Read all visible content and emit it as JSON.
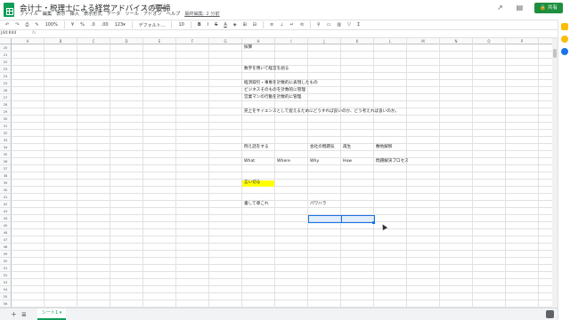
{
  "title": "会计士・税理士による経営アドバイスの要諦",
  "menu": [
    "ファイル",
    "編集",
    "表示",
    "挿入",
    "表示形式",
    "データ",
    "ツール",
    "アドオン",
    "ヘルプ",
    "最終編集: 2 分前"
  ],
  "share_label": "共有",
  "toolbar": {
    "zoom": "100%",
    "currency": "¥",
    "percent": "%",
    "dec0": ".0",
    "dec00": ".00",
    "numfmt": "123▾",
    "font": "デフォルト...",
    "size": "10",
    "bold": "B",
    "italic": "I",
    "strike": "S",
    "textcolor": "A"
  },
  "formula": {
    "namebox": "J44:K44",
    "fx": "fx"
  },
  "columns": [
    "A",
    "B",
    "C",
    "D",
    "E",
    "F",
    "G",
    "H",
    "I",
    "J",
    "K",
    "L",
    "M",
    "N",
    "O",
    "P",
    "Q"
  ],
  "rows": [
    "20",
    "21",
    "22",
    "23",
    "24",
    "25",
    "26",
    "27",
    "28",
    "29",
    "30",
    "31",
    "32",
    "33",
    "34",
    "35",
    "36",
    "37",
    "38",
    "39",
    "40",
    "41",
    "42",
    "43",
    "44",
    "45",
    "46",
    "47",
    "48",
    "49",
    "50",
    "51",
    "52",
    "53",
    "54",
    "55",
    "56",
    "57",
    "58"
  ],
  "cells": {
    "r20": "採算",
    "r23": "数字を用いて経営を語る",
    "r25": "経済取引・事象を計数的に表現したもの",
    "r26": "ビジネスそのものを計数的に管理",
    "r27": "営業マンの行動を計数的に管理",
    "r29": "売上をサイエンスとして捉えるためにどうすれば良いのか、どう考えれば良いのか。",
    "r34_h": "例え話をする",
    "r34_j": "会社の問題気",
    "r34_k": "再生",
    "r34_l": "敷地解釈",
    "r36_h": "What",
    "r36_i": "Where",
    "r36_j": "Why",
    "r36_k": "How",
    "r36_l": "問題解決プロセス",
    "r39_h": "言い切る",
    "r42_h": "書して導これ",
    "r42_j": "パワハラ"
  },
  "sheet_tab": "シート1",
  "colors": {
    "brand_green": "#0f9d58",
    "share_green": "#1e8e3e",
    "highlight": "#ffff00",
    "selection": "#1a73e8"
  },
  "icons": [
    "sheets-logo",
    "star-icon",
    "move-icon",
    "cloud-icon",
    "trend-icon",
    "comment-icon",
    "lock-icon",
    "undo-icon",
    "redo-icon",
    "print-icon",
    "paint-format-icon",
    "add-sheet-icon",
    "all-sheets-icon",
    "explore-icon"
  ]
}
